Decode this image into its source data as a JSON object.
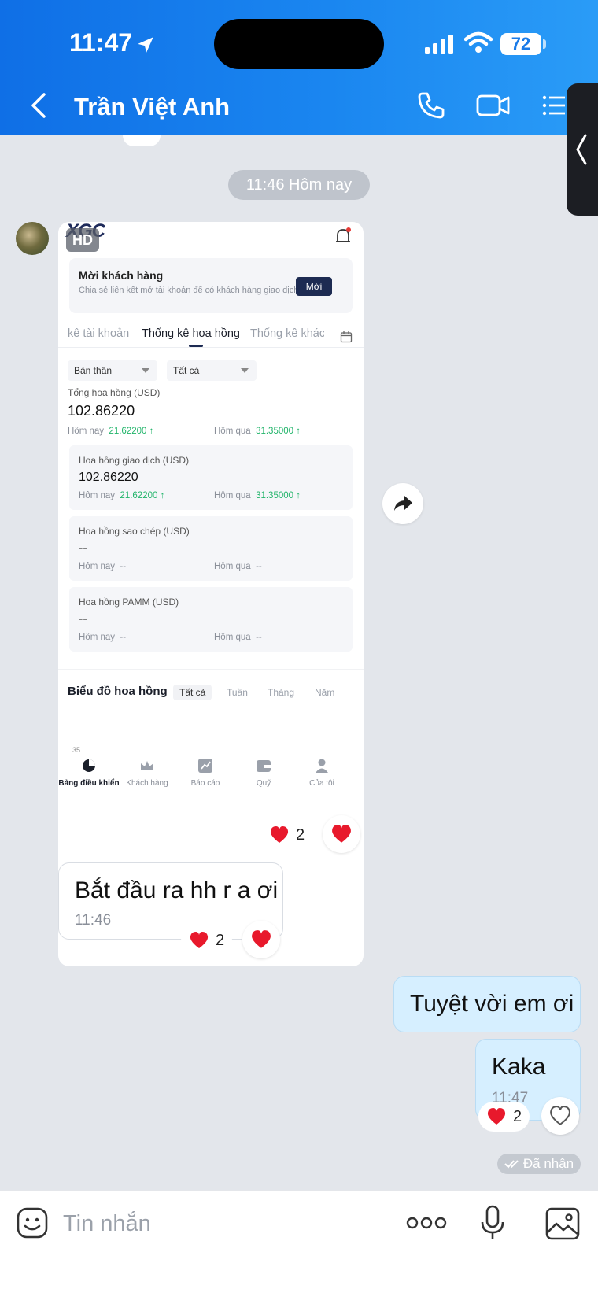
{
  "status_bar": {
    "time": "11:47",
    "battery": "72"
  },
  "header": {
    "title": "Trần Việt Anh"
  },
  "chat": {
    "date_divider": "11:46 Hôm nay",
    "image_message": {
      "hd_badge": "HD",
      "logo": "XGC",
      "invite": {
        "title": "Mời khách hàng",
        "subtitle": "Chia sẻ liên kết mở tài khoản để có khách hàng giao dịch",
        "button": "Mời"
      },
      "tabs": [
        "kê tài khoản",
        "Thống kê hoa hồng",
        "Thống kê khác"
      ],
      "filters": [
        "Bản thân",
        "Tất cả"
      ],
      "total": {
        "label": "Tổng hoa hồng (USD)",
        "value": "102.86220",
        "today_label": "Hôm nay",
        "today_value": "21.62200",
        "yesterday_label": "Hôm qua",
        "yesterday_value": "31.35000"
      },
      "boxes": [
        {
          "label": "Hoa hồng giao dịch (USD)",
          "value": "102.86220",
          "today_label": "Hôm nay",
          "today_value": "21.62200",
          "yesterday_label": "Hôm qua",
          "yesterday_value": "31.35000"
        },
        {
          "label": "Hoa hồng sao chép (USD)",
          "value": "--",
          "today_label": "Hôm nay",
          "today_value": "--",
          "yesterday_label": "Hôm qua",
          "yesterday_value": "--"
        },
        {
          "label": "Hoa hồng PAMM (USD)",
          "value": "--",
          "today_label": "Hôm nay",
          "today_value": "--",
          "yesterday_label": "Hôm qua",
          "yesterday_value": "--"
        }
      ],
      "chart_title": "Biểu đồ hoa hồng",
      "periods": [
        "Tất cả",
        "Tuần",
        "Tháng",
        "Năm"
      ],
      "axis_tick": "35",
      "nav": [
        "Bảng điều khiển",
        "Khách hàng",
        "Báo cáo",
        "Quỹ",
        "Của tôi"
      ],
      "reaction_count": "2"
    },
    "messages": [
      {
        "text": "Bắt đầu ra hh r a ơi",
        "time": "11:46",
        "reaction_count": "2"
      },
      {
        "text": "Tuyệt vời em ơi"
      },
      {
        "text": "Kaka",
        "time": "11:47",
        "reaction_count": "2"
      }
    ],
    "seen": "Đã nhận"
  },
  "composer": {
    "placeholder": "Tin nhắn"
  },
  "colors": {
    "header": "#1a86f0",
    "reaction": "#e8192c",
    "out_bubble": "#d6efff"
  }
}
